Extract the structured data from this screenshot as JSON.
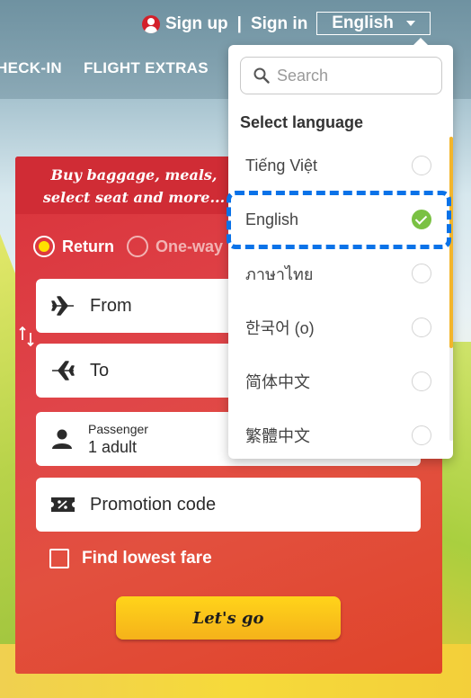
{
  "header": {
    "sign_up": "Sign up",
    "separator": "|",
    "sign_in": "Sign in",
    "language_button": "English",
    "nav": [
      "HECK-IN",
      "FLIGHT EXTRAS"
    ]
  },
  "booking": {
    "promo_banner": "Buy baggage, meals, select seat and more...",
    "trip_types": [
      {
        "label": "Return",
        "selected": true
      },
      {
        "label": "One-way",
        "selected": false
      }
    ],
    "from_label": "From",
    "to_label": "To",
    "passenger_label": "Passenger",
    "passenger_value": "1 adult",
    "promotion_label": "Promotion code",
    "lowest_fare_label": "Find lowest fare",
    "submit_label": "Let's go"
  },
  "language_menu": {
    "search_placeholder": "Search",
    "title": "Select language",
    "options": [
      {
        "label": "Tiếng Việt",
        "selected": false
      },
      {
        "label": "English",
        "selected": true
      },
      {
        "label": "ภาษาไทย",
        "selected": false
      },
      {
        "label": "한국어 (o)",
        "selected": false
      },
      {
        "label": "简体中文",
        "selected": false
      },
      {
        "label": "繁體中文",
        "selected": false
      }
    ]
  },
  "colors": {
    "brand_red": "#d02c35",
    "accent_yellow": "#ffd41a",
    "check_green": "#7ac143",
    "highlight_blue": "#0a72e8"
  }
}
